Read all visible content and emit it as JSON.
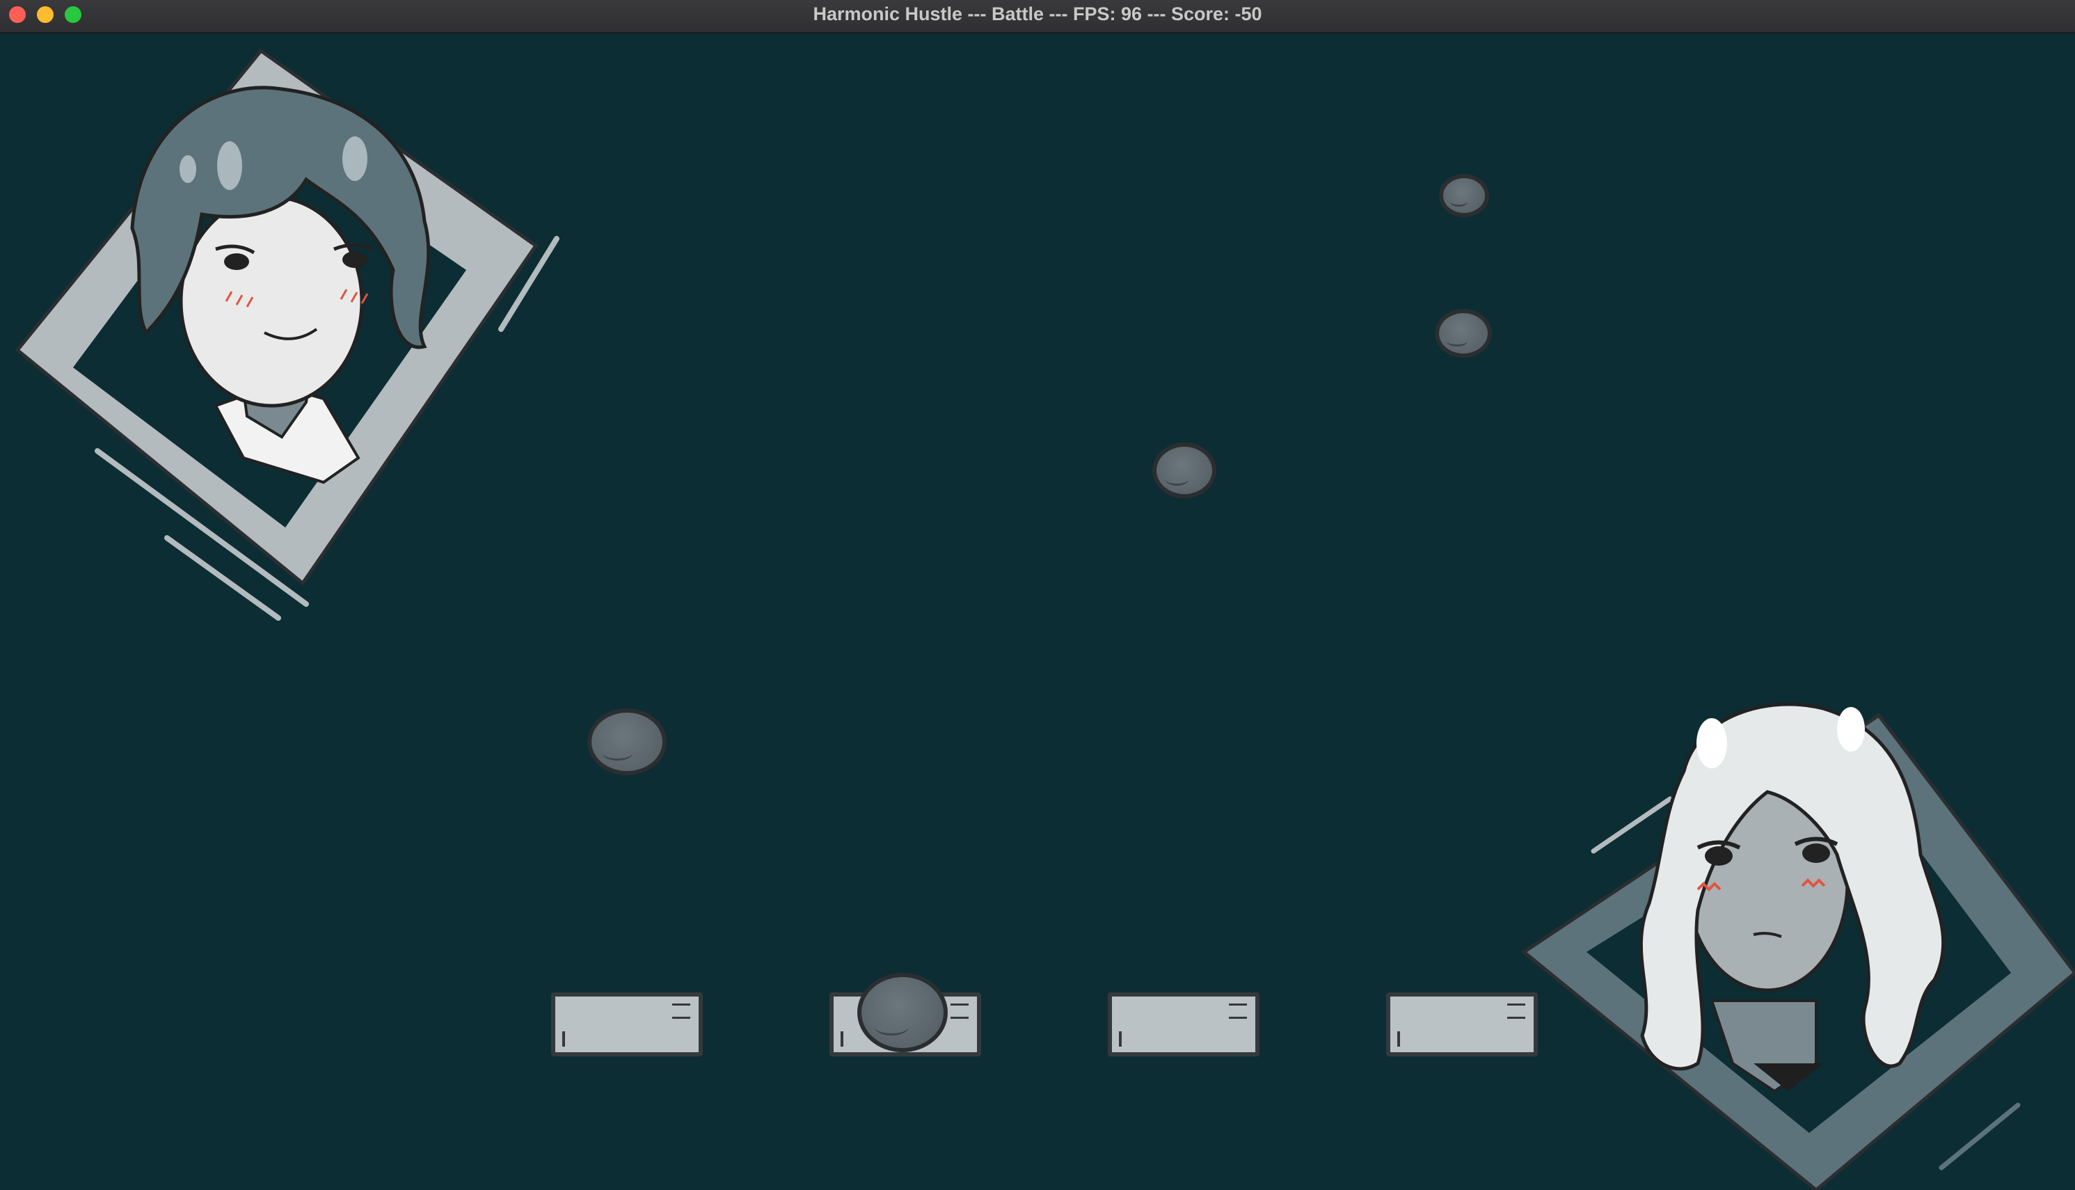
{
  "window": {
    "title": "Harmonic Hustle --- Battle --- FPS: 96 --- Score: -50"
  },
  "game": {
    "colors": {
      "background": "#0c2d33",
      "note": "#5f686e",
      "receptor": "#bac2c6",
      "frame_left": "#b3bbbf",
      "frame_right": "#5d737b"
    },
    "lanes": 4,
    "falling_notes": 5,
    "characters": [
      "short-haired-girl-portrait",
      "long-haired-girl-portrait"
    ]
  }
}
